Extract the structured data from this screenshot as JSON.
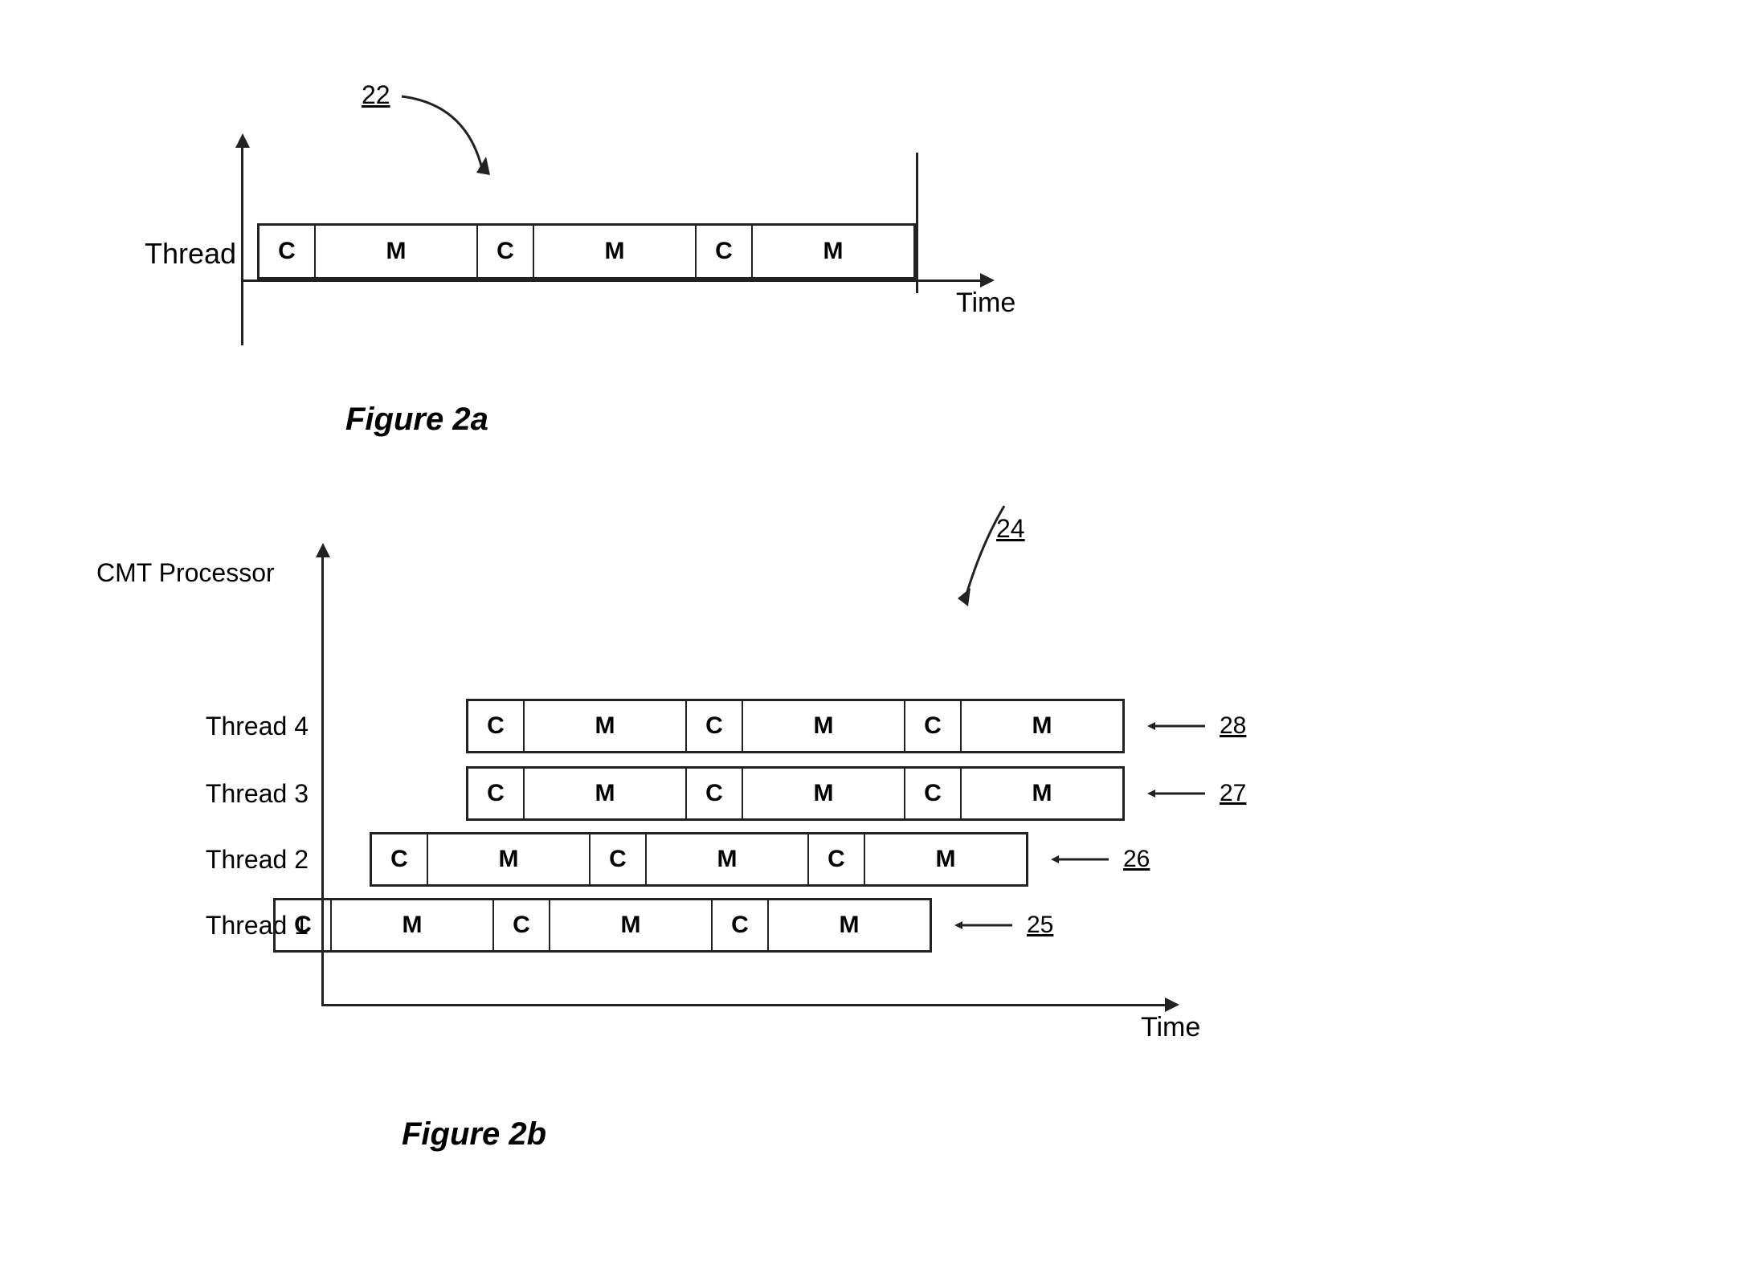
{
  "fig2a": {
    "label_number": "22",
    "thread_label": "Thread",
    "time_label": "Time",
    "caption": "Figure 2a",
    "segments": [
      "C",
      "M",
      "C",
      "M",
      "C",
      "M"
    ]
  },
  "fig2b": {
    "label_number": "24",
    "cmt_label": "CMT Processor",
    "time_label": "Time",
    "caption": "Figure 2b",
    "threads": [
      {
        "label": "Thread 1",
        "ref": "25"
      },
      {
        "label": "Thread 2",
        "ref": "26"
      },
      {
        "label": "Thread 3",
        "ref": "27"
      },
      {
        "label": "Thread 4",
        "ref": "28"
      }
    ],
    "segments": [
      "C",
      "M",
      "C",
      "M",
      "C",
      "M"
    ]
  }
}
